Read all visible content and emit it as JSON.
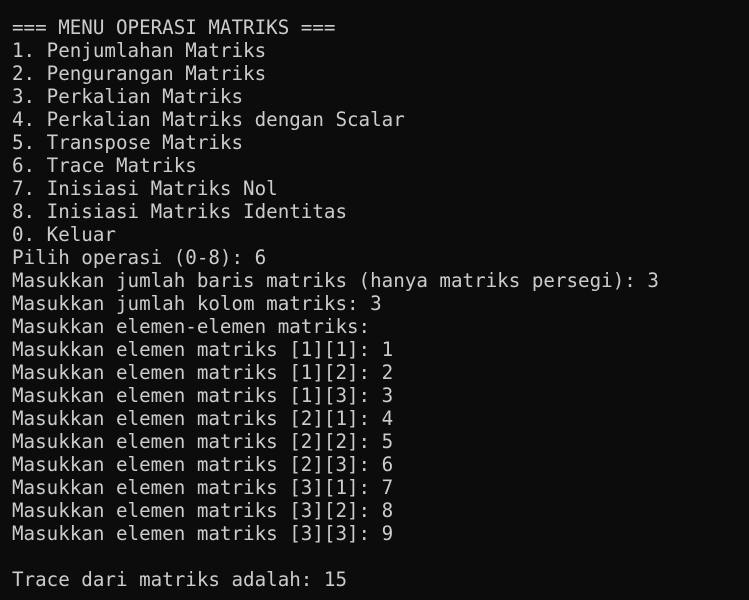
{
  "colors": {
    "background": "#0c0c0c",
    "text": "#cccccc"
  },
  "terminal": {
    "lines": [
      "=== MENU OPERASI MATRIKS ===",
      "1. Penjumlahan Matriks",
      "2. Pengurangan Matriks",
      "3. Perkalian Matriks",
      "4. Perkalian Matriks dengan Scalar",
      "5. Transpose Matriks",
      "6. Trace Matriks",
      "7. Inisiasi Matriks Nol",
      "8. Inisiasi Matriks Identitas",
      "0. Keluar",
      "Pilih operasi (0-8): 6",
      "Masukkan jumlah baris matriks (hanya matriks persegi): 3",
      "Masukkan jumlah kolom matriks: 3",
      "Masukkan elemen-elemen matriks:",
      "Masukkan elemen matriks [1][1]: 1",
      "Masukkan elemen matriks [1][2]: 2",
      "Masukkan elemen matriks [1][3]: 3",
      "Masukkan elemen matriks [2][1]: 4",
      "Masukkan elemen matriks [2][2]: 5",
      "Masukkan elemen matriks [2][3]: 6",
      "Masukkan elemen matriks [3][1]: 7",
      "Masukkan elemen matriks [3][2]: 8",
      "Masukkan elemen matriks [3][3]: 9",
      "",
      "Trace dari matriks adalah: 15"
    ]
  }
}
